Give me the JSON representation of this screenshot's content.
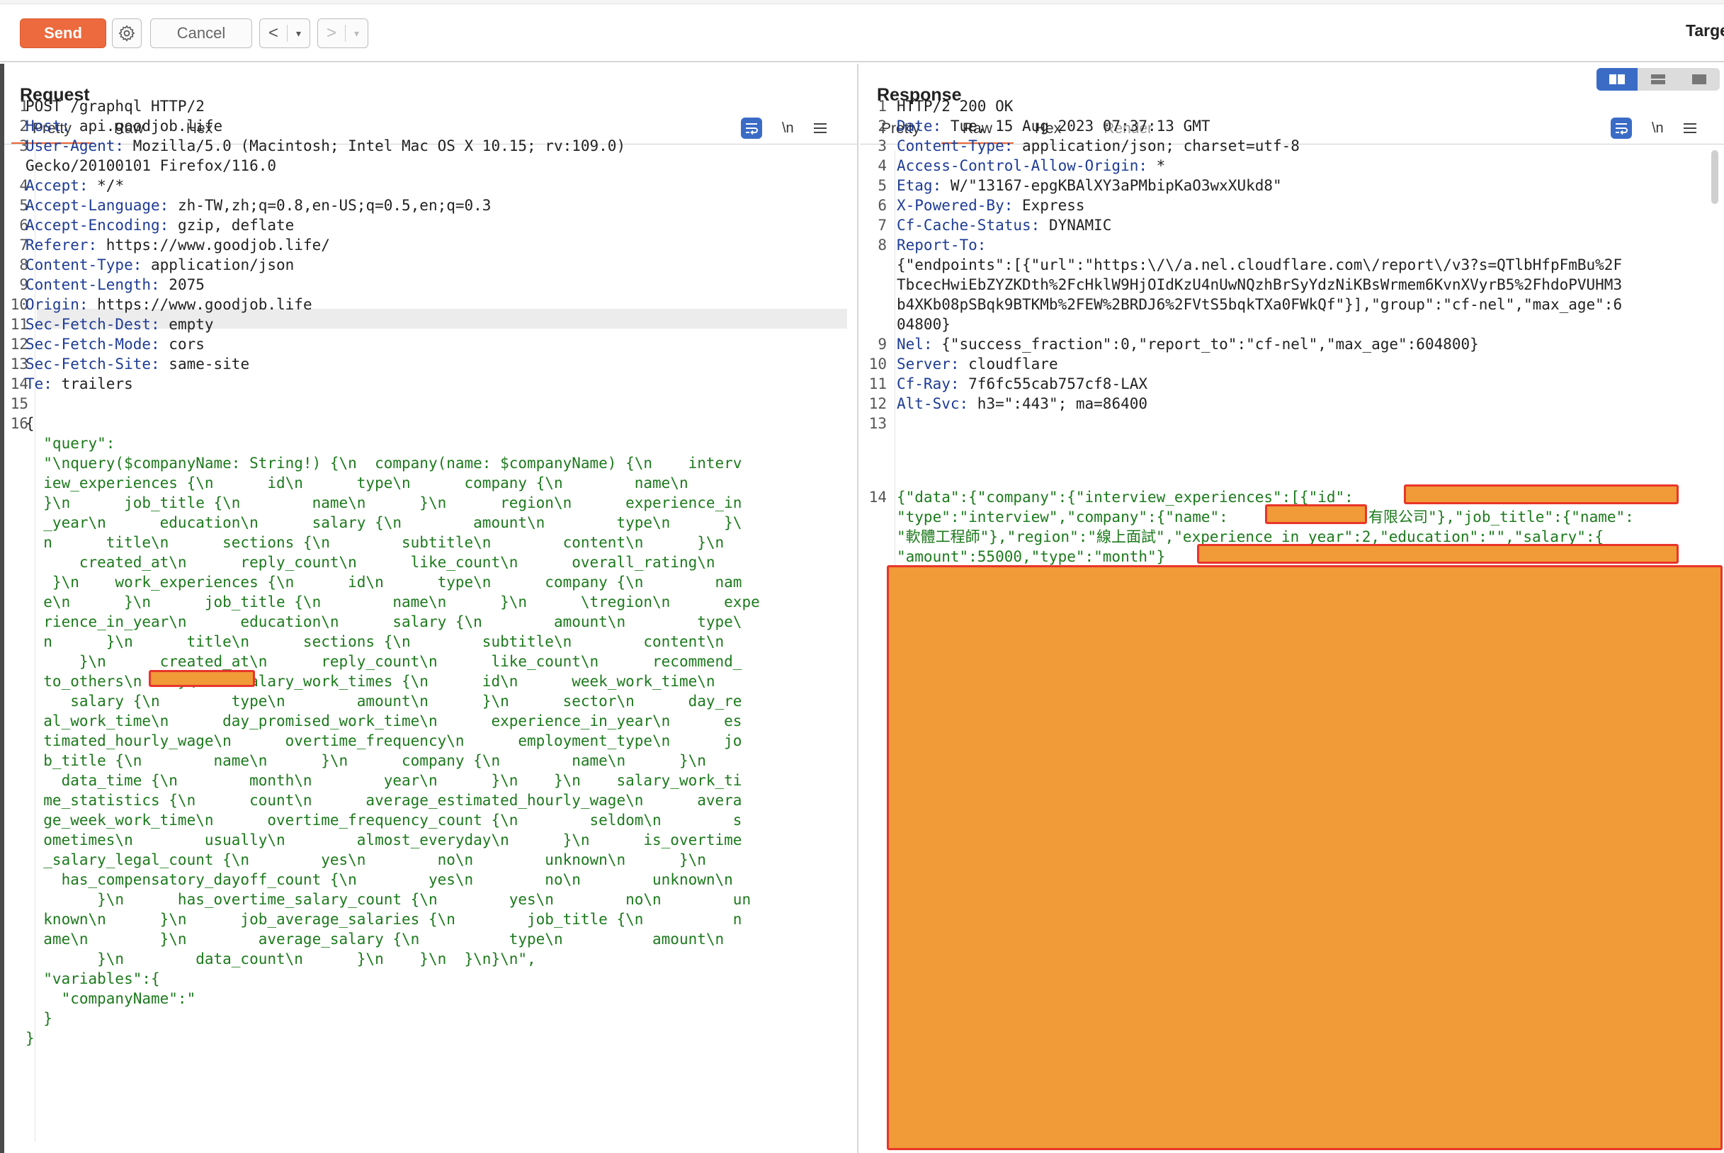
{
  "toolbar": {
    "send_label": "Send",
    "cancel_label": "Cancel",
    "back_glyph": "<",
    "forward_glyph": ">",
    "dropdown_glyph": "▾",
    "target_label": "Targe"
  },
  "request": {
    "title": "Request",
    "tabs": [
      "Pretty",
      "Raw",
      "Hex"
    ],
    "active_tab": "Pretty",
    "newline_toggle": "\\n",
    "lines": [
      {
        "n": "1",
        "k": "",
        "v": "POST /graphql HTTP/2"
      },
      {
        "n": "2",
        "k": "Host",
        "v": " api.goodjob.life"
      },
      {
        "n": "3",
        "k": "User-Agent",
        "v": " Mozilla/5.0 (Macintosh; Intel Mac OS X 10.15; rv:109.0)"
      },
      {
        "n": "",
        "k": "",
        "v": "Gecko/20100101 Firefox/116.0"
      },
      {
        "n": "4",
        "k": "Accept",
        "v": " */*"
      },
      {
        "n": "5",
        "k": "Accept-Language",
        "v": " zh-TW,zh;q=0.8,en-US;q=0.5,en;q=0.3"
      },
      {
        "n": "6",
        "k": "Accept-Encoding",
        "v": " gzip, deflate"
      },
      {
        "n": "7",
        "k": "Referer",
        "v": " https://www.goodjob.life/"
      },
      {
        "n": "8",
        "k": "Content-Type",
        "v": " application/json"
      },
      {
        "n": "9",
        "k": "Content-Length",
        "v": " 2075"
      },
      {
        "n": "10",
        "k": "Origin",
        "v": " https://www.goodjob.life"
      },
      {
        "n": "11",
        "k": "Sec-Fetch-Dest",
        "v": " empty"
      },
      {
        "n": "12",
        "k": "Sec-Fetch-Mode",
        "v": " cors"
      },
      {
        "n": "13",
        "k": "Sec-Fetch-Site",
        "v": " same-site"
      },
      {
        "n": "14",
        "k": "Te",
        "v": " trailers"
      },
      {
        "n": "15",
        "k": "",
        "v": ""
      },
      {
        "n": "16",
        "k": "",
        "v": "{"
      }
    ],
    "body_lines": [
      "  \"query\":",
      "  \"\\nquery($companyName: String!) {\\n  company(name: $companyName) {\\n    interv",
      "  iew_experiences {\\n      id\\n      type\\n      company {\\n        name\\n",
      "  }\\n      job_title {\\n        name\\n      }\\n      region\\n      experience_in",
      "  _year\\n      education\\n      salary {\\n        amount\\n        type\\n      }\\",
      "  n      title\\n      sections {\\n        subtitle\\n        content\\n      }\\n",
      "      created_at\\n      reply_count\\n      like_count\\n      overall_rating\\n",
      "   }\\n    work_experiences {\\n      id\\n      type\\n      company {\\n        nam",
      "  e\\n      }\\n      job_title {\\n        name\\n      }\\n      \\tregion\\n      expe",
      "  rience_in_year\\n      education\\n      salary {\\n        amount\\n        type\\",
      "  n      }\\n      title\\n      sections {\\n        subtitle\\n        content\\n",
      "      }\\n      created_at\\n      reply_count\\n      like_count\\n      recommend_",
      "  to_others\\n    }\\n    salary_work_times {\\n      id\\n      week_work_time\\n",
      "     salary {\\n        type\\n        amount\\n      }\\n      sector\\n      day_re",
      "  al_work_time\\n      day_promised_work_time\\n      experience_in_year\\n      es",
      "  timated_hourly_wage\\n      overtime_frequency\\n      employment_type\\n      jo",
      "  b_title {\\n        name\\n      }\\n      company {\\n        name\\n      }\\n",
      "    data_time {\\n        month\\n        year\\n      }\\n    }\\n    salary_work_ti",
      "  me_statistics {\\n      count\\n      average_estimated_hourly_wage\\n      avera",
      "  ge_week_work_time\\n      overtime_frequency_count {\\n        seldom\\n        s",
      "  ometimes\\n        usually\\n        almost_everyday\\n      }\\n      is_overtime",
      "  _salary_legal_count {\\n        yes\\n        no\\n        unknown\\n      }\\n",
      "    has_compensatory_dayoff_count {\\n        yes\\n        no\\n        unknown\\n",
      "        }\\n      has_overtime_salary_count {\\n        yes\\n        no\\n        un",
      "  known\\n      }\\n      job_average_salaries {\\n        job_title {\\n          n",
      "  ame\\n        }\\n        average_salary {\\n          type\\n          amount\\n",
      "        }\\n        data_count\\n      }\\n    }\\n  }\\n}\\n\",",
      "  \"variables\":{",
      "    \"companyName\":\"",
      "  }",
      "}"
    ]
  },
  "response": {
    "title": "Response",
    "tabs": [
      "Pretty",
      "Raw",
      "Hex",
      "Render"
    ],
    "active_tab": "Raw",
    "newline_toggle": "\\n",
    "lines": [
      {
        "n": "1",
        "k": "",
        "v": "HTTP/2 200 OK"
      },
      {
        "n": "2",
        "k": "Date",
        "v": " Tue, 15 Aug 2023 07:37:13 GMT"
      },
      {
        "n": "3",
        "k": "Content-Type",
        "v": " application/json; charset=utf-8"
      },
      {
        "n": "4",
        "k": "Access-Control-Allow-Origin",
        "v": " *"
      },
      {
        "n": "5",
        "k": "Etag",
        "v": " W/\"13167-epgKBAlXY3aPMbipKaO3wxXUkd8\""
      },
      {
        "n": "6",
        "k": "X-Powered-By",
        "v": " Express"
      },
      {
        "n": "7",
        "k": "Cf-Cache-Status",
        "v": " DYNAMIC"
      },
      {
        "n": "8",
        "k": "Report-To",
        "v": ""
      },
      {
        "n": "",
        "k": "",
        "v": "{\"endpoints\":[{\"url\":\"https:\\/\\/a.nel.cloudflare.com\\/report\\/v3?s=QTlbHfpFmBu%2F"
      },
      {
        "n": "",
        "k": "",
        "v": "TbcecHwiEbZYZKDth%2FcHklW9HjOIdKzU4nUwNQzhBrSyYdzNiKBsWrmem6KvnXVyrB5%2FhdoPVUHM3"
      },
      {
        "n": "",
        "k": "",
        "v": "b4XKb08pSBqk9BTKMb%2FEW%2BRDJ6%2FVtS5bqkTXa0FWkQf\"}],\"group\":\"cf-nel\",\"max_age\":6"
      },
      {
        "n": "",
        "k": "",
        "v": "04800}"
      },
      {
        "n": "9",
        "k": "Nel",
        "v": " {\"success_fraction\":0,\"report_to\":\"cf-nel\",\"max_age\":604800}"
      },
      {
        "n": "10",
        "k": "Server",
        "v": " cloudflare"
      },
      {
        "n": "11",
        "k": "Cf-Ray",
        "v": " 7f6fc55cab757cf8-LAX"
      },
      {
        "n": "12",
        "k": "Alt-Svc",
        "v": " h3=\":443\"; ma=86400"
      },
      {
        "n": "13",
        "k": "",
        "v": ""
      }
    ],
    "body_line_1": "{\"data\":{\"company\":{\"interview_experiences\":[{\"id\":",
    "body_line_2a": "\"type\":\"interview\",\"company\":{\"name\":",
    "body_line_2b": "有限公司\"},\"job_title\":{\"name\":",
    "body_line_3": "\"軟體工程師\"},\"region\":\"線上面試\",\"experience_in_year\":2,\"education\":\"\",\"salary\":{",
    "body_line_4": "\"amount\":55000,\"type\":\"month\"}",
    "body_line_num": "14"
  },
  "colors": {
    "accent": "#ec6a3d",
    "header_key": "#1e3c96",
    "json_text": "#1c7a1c",
    "redaction_fill": "#f09a38",
    "redaction_border": "#e8352a",
    "toggle_active": "#3a6cc6"
  },
  "icons": {
    "settings": "gear-icon",
    "wrap": "text-wrap-icon",
    "menu": "hamburger-menu-icon",
    "layout": [
      "side-by-side-layout-icon",
      "stacked-layout-icon",
      "single-pane-layout-icon"
    ]
  }
}
